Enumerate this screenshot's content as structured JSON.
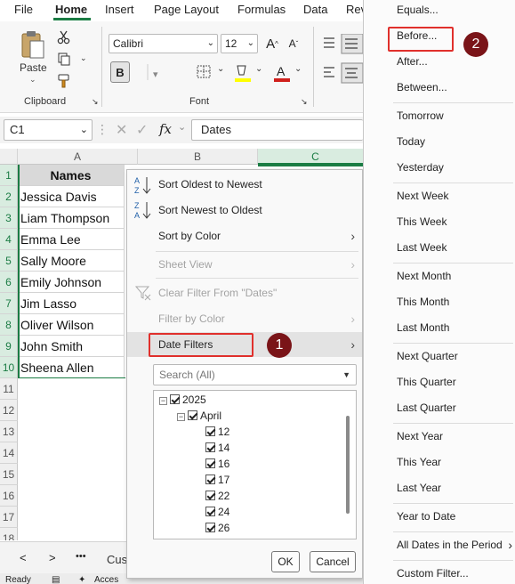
{
  "ribbon": {
    "tabs": [
      "File",
      "Home",
      "Insert",
      "Page Layout",
      "Formulas",
      "Data",
      "Rev"
    ],
    "active_tab": "Home",
    "clipboard": {
      "paste_label": "Paste",
      "group_label": "Clipboard"
    },
    "font": {
      "name": "Calibri",
      "size": "12",
      "group_label": "Font",
      "bold": "B",
      "grow": "A",
      "shrink": "A"
    }
  },
  "formula_bar": {
    "name_box": "C1",
    "fx": "fx",
    "value": "Dates"
  },
  "sheet": {
    "col_headers": [
      "A",
      "B",
      "C"
    ],
    "row_numbers": [
      "1",
      "2",
      "3",
      "4",
      "5",
      "6",
      "7",
      "8",
      "9",
      "10",
      "11",
      "12",
      "13",
      "14",
      "15",
      "16",
      "17",
      "18"
    ],
    "header": "Names",
    "names": [
      "Jessica Davis",
      "Liam Thompson",
      "Emma Lee",
      "Sally Moore",
      "Emily Johnson",
      "Jim Lasso",
      "Oliver Wilson",
      "John Smith",
      "Sheena Allen"
    ],
    "tab_partial": "Cus",
    "more_tabs": "•••",
    "status_ready": "Ready",
    "status_partial": "Acces"
  },
  "context_menu": {
    "sort_oldest": "Sort Oldest to Newest",
    "sort_newest": "Sort Newest to Oldest",
    "sort_color": "Sort by Color",
    "sheet_view": "Sheet View",
    "clear_filter": "Clear Filter From \"Dates\"",
    "filter_color": "Filter by Color",
    "date_filters": "Date Filters",
    "search_placeholder": "Search (All)",
    "tree": {
      "year": "2025",
      "month": "April",
      "days": [
        "12",
        "14",
        "16",
        "17",
        "22",
        "24",
        "26"
      ]
    },
    "ok": "OK",
    "cancel": "Cancel"
  },
  "submenu": {
    "items": [
      "Equals...",
      "Before...",
      "After...",
      "Between...",
      "Tomorrow",
      "Today",
      "Yesterday",
      "Next Week",
      "This Week",
      "Last Week",
      "Next Month",
      "This Month",
      "Last Month",
      "Next Quarter",
      "This Quarter",
      "Last Quarter",
      "Next Year",
      "This Year",
      "Last Year",
      "Year to Date",
      "All Dates in the Period",
      "Custom Filter..."
    ]
  },
  "callouts": {
    "one": "1",
    "two": "2"
  },
  "colors": {
    "excel_green": "#1b7c44",
    "callout_red": "#e0302c",
    "badge": "#7a1418"
  }
}
